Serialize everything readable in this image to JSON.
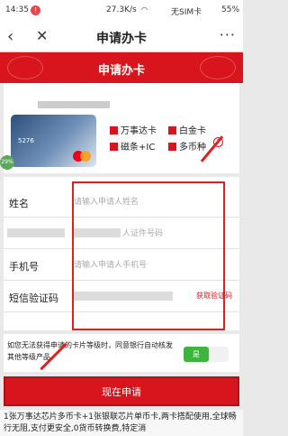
{
  "status_bar": {
    "time": "14:35",
    "warning": "!",
    "speed": "27.3K/s",
    "carrier": "无SIM卡",
    "battery": "55%"
  },
  "nav": {
    "back": "‹",
    "close": "✕",
    "title": "申请办卡",
    "more": "···"
  },
  "banner": {
    "title": "申请办卡"
  },
  "card_options": {
    "card_number": "5276",
    "edge_badge": "29%",
    "options": [
      {
        "label": "万事达卡"
      },
      {
        "label": "白金卡"
      },
      {
        "label": "磁条+IC"
      },
      {
        "label": "多币种"
      }
    ],
    "help": "?"
  },
  "form": {
    "name": {
      "label": "姓名",
      "placeholder": "请输入申请人姓名"
    },
    "id": {
      "placeholder": "人证件号码"
    },
    "phone": {
      "label": "手机号",
      "placeholder": "请输入申请人手机号"
    },
    "sms": {
      "label": "短信验证码",
      "button": "获取验证码"
    }
  },
  "consent": {
    "text": "如您无法获得申请的卡片等级时，同意银行自动核发其他等级产品",
    "toggle": "是"
  },
  "apply_button": "现在申请",
  "footnote": "1张万事达芯片多币卡+1张银联芯片单币卡,两卡搭配使用,全球畅行无阻,支付更安全,0货币转换费,特定消"
}
